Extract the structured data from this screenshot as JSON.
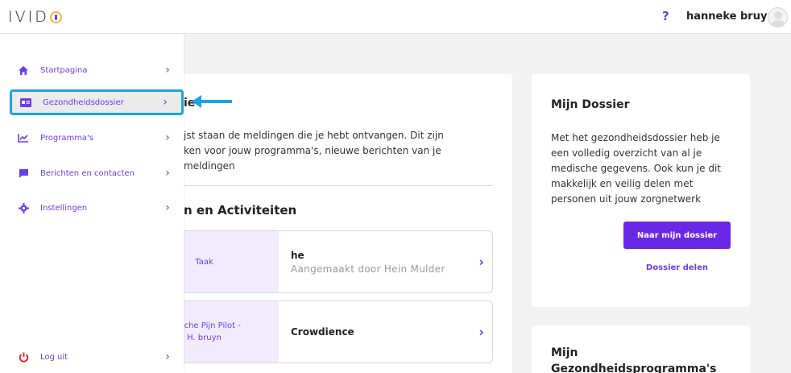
{
  "app": {
    "logo": "IVID",
    "help": "?",
    "user_name": "hanneke bruyn"
  },
  "sidebar": {
    "items": [
      {
        "label": "Startpagina",
        "icon": "home-icon"
      },
      {
        "label": "Gezondheidsdossier",
        "icon": "id-card-icon"
      },
      {
        "label": "Programma's",
        "icon": "chart-line-icon"
      },
      {
        "label": "Berichten en contacten",
        "icon": "chat-icon"
      },
      {
        "label": "Instellingen",
        "icon": "gear-icon"
      }
    ],
    "logout": {
      "label": "Log uit",
      "icon": "power-icon"
    },
    "chevron": "›"
  },
  "main": {
    "partial_title": "ie",
    "intro_lines": [
      "jst staan de meldingen die je hebt ontvangen. Dit zijn",
      "ken voor jouw programma's, nieuwe berichten van je",
      "meldingen"
    ],
    "section_title": "n en Activiteiten",
    "tasks": [
      {
        "type": "Taak",
        "title": "he",
        "subtitle": "Aangemaakt door Hein Mulder"
      },
      {
        "type_line1": "onische Pijn Pilot -",
        "type_line2": "H. bruyn",
        "title": "Crowdience"
      }
    ]
  },
  "dossier": {
    "title": "Mijn Dossier",
    "text_lines": [
      "Met het gezondheidsdossier heb je",
      "een volledig overzicht van al je",
      "medische gegevens. Ook kun je dit",
      "makkelijk en veilig delen met",
      "personen uit jouw zorgnetwerk"
    ],
    "button": "Naar mijn dossier",
    "link": "Dossier delen"
  },
  "programs": {
    "title_line1": "Mijn",
    "title_line2": "Gezondheidsprogramma's"
  },
  "colors": {
    "accent": "#6a3de8",
    "highlight": "#1aa3e8",
    "task_bg": "#f1ebfd",
    "logout_icon": "#e02020"
  }
}
